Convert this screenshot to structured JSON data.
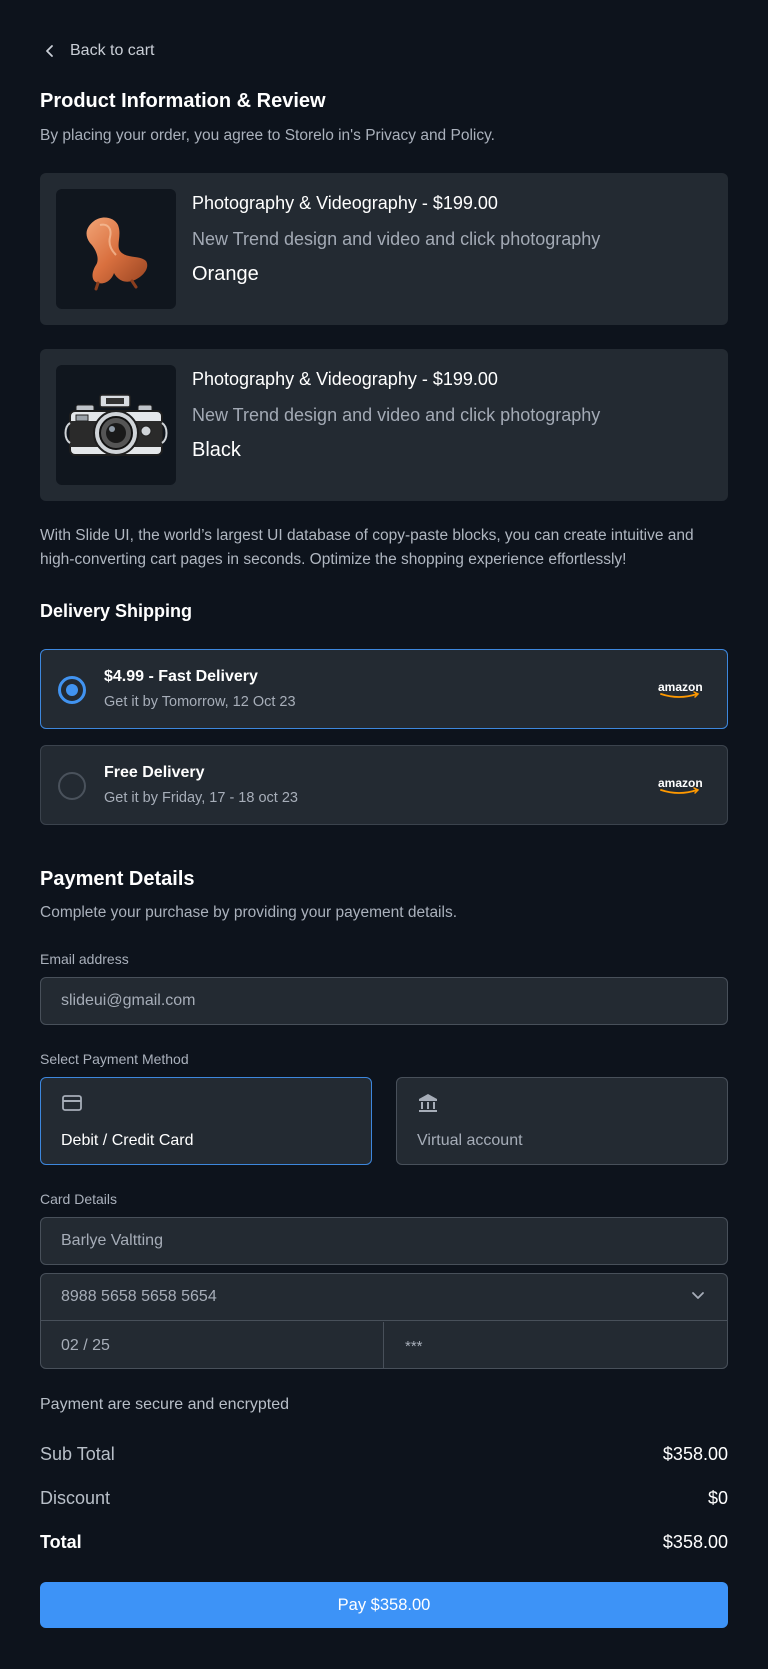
{
  "nav": {
    "back_label": "Back to cart"
  },
  "header": {
    "title": "Product Information & Review",
    "subtitle": "By placing your order, you agree to Storelo in's Privacy and Policy."
  },
  "products": [
    {
      "title": "Photography & Videography - $199.00",
      "description": "New Trend design and video and click photography",
      "color": "Orange",
      "image": "orange-chair"
    },
    {
      "title": "Photography & Videography - $199.00",
      "description": "New Trend design and video and click photography",
      "color": "Black",
      "image": "vintage-camera"
    }
  ],
  "promo_text": "With Slide UI, the world’s largest UI database of copy-paste blocks, you can create intuitive and high-converting cart pages in seconds. Optimize the shopping experience effortlessly!",
  "delivery": {
    "title": "Delivery Shipping",
    "options": [
      {
        "title": "$4.99 - Fast Delivery",
        "subtitle": "Get it by Tomorrow, 12 Oct 23",
        "carrier": "amazon",
        "selected": true
      },
      {
        "title": "Free Delivery",
        "subtitle": "Get it by Friday, 17 - 18 oct 23",
        "carrier": "amazon",
        "selected": false
      }
    ]
  },
  "payment": {
    "title": "Payment Details",
    "subtitle": "Complete your purchase by providing your payement details.",
    "email_label": "Email address",
    "email_value": "slideui@gmail.com",
    "method_label": "Select Payment Method",
    "methods": [
      {
        "label": "Debit / Credit Card",
        "icon": "credit-card-icon",
        "selected": true
      },
      {
        "label": "Virtual account",
        "icon": "bank-icon",
        "selected": false
      }
    ],
    "card_label": "Card Details",
    "card_name": "Barlye Valtting",
    "card_number": "8988 5658 5658 5654",
    "card_expiry": "02 / 25",
    "card_cvc": "***"
  },
  "summary": {
    "secure_text": "Payment are secure and encrypted",
    "subtotal_label": "Sub Total",
    "subtotal_value": "$358.00",
    "discount_label": "Discount",
    "discount_value": "$0",
    "total_label": "Total",
    "total_value": "$358.00"
  },
  "pay_button": "Pay $358.00",
  "colors": {
    "background": "#0d131c",
    "card": "#232a32",
    "accent": "#3d93f7"
  }
}
